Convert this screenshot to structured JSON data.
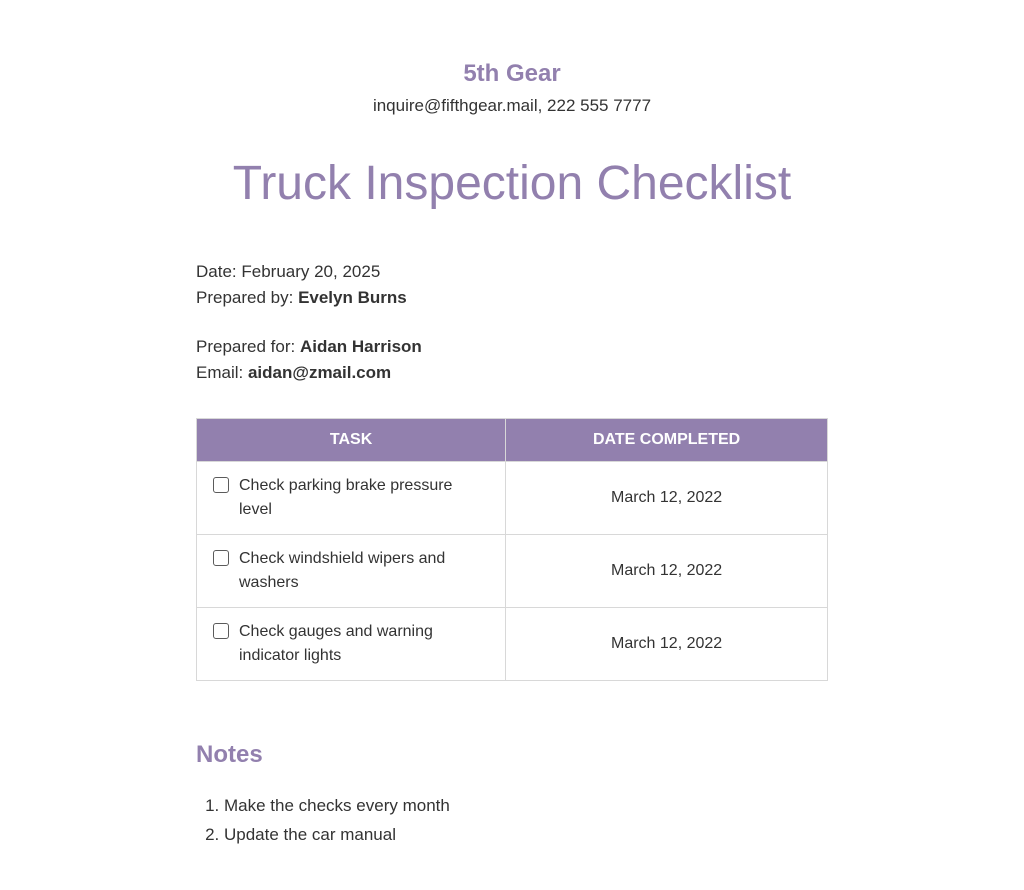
{
  "header": {
    "company_name": "5th Gear",
    "contact": "inquire@fifthgear.mail, 222 555 7777"
  },
  "title": "Truck Inspection Checklist",
  "meta": {
    "date_label": "Date: ",
    "date_value": "February 20, 2025",
    "prepared_by_label": "Prepared by: ",
    "prepared_by_value": "Evelyn Burns",
    "prepared_for_label": "Prepared for: ",
    "prepared_for_value": "Aidan Harrison",
    "email_label": "Email: ",
    "email_value": "aidan@zmail.com"
  },
  "table": {
    "headers": {
      "task": "TASK",
      "date_completed": "DATE COMPLETED"
    },
    "rows": [
      {
        "task": "Check parking brake pressure level",
        "date": "March 12, 2022"
      },
      {
        "task": "Check windshield wipers and washers",
        "date": "March 12, 2022"
      },
      {
        "task": "Check gauges and warning indicator lights",
        "date": "March 12, 2022"
      }
    ]
  },
  "notes": {
    "heading": "Notes",
    "items": [
      "Make the checks every month",
      "Update the car manual"
    ]
  }
}
